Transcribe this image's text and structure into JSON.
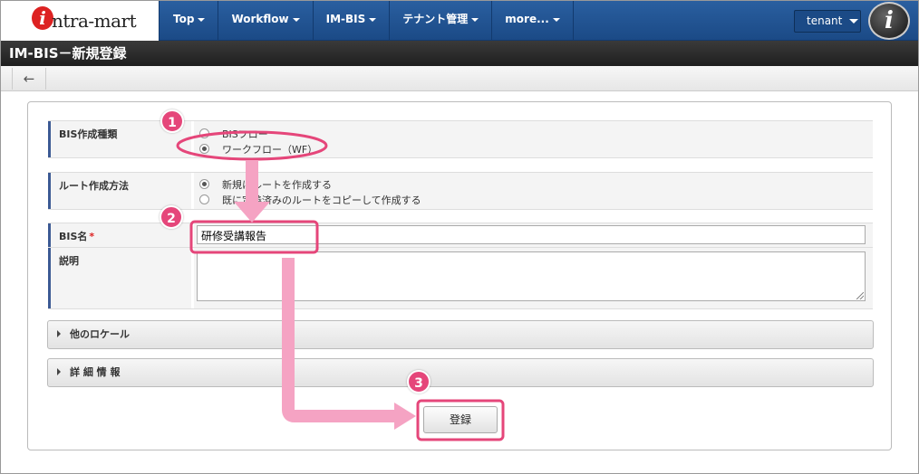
{
  "app": {
    "logo_text": "ntra-mart",
    "logo_mark": "i",
    "avatar_mark": "i"
  },
  "nav": [
    {
      "label": "Top"
    },
    {
      "label": "Workflow"
    },
    {
      "label": "IM-BIS"
    },
    {
      "label": "テナント管理"
    },
    {
      "label": "more..."
    }
  ],
  "tenant_label": "tenant",
  "page_title": "IM-BIS－新規登録",
  "back_icon": "←",
  "form": {
    "bis_type": {
      "label": "BIS作成種類",
      "options": [
        "BISフロー",
        "ワークフロー（WF）"
      ],
      "selected": 1
    },
    "route_method": {
      "label": "ルート作成方法",
      "options": [
        "新規にルートを作成する",
        "既に定義済みのルートをコピーして作成する"
      ],
      "selected": 0
    },
    "bis_name": {
      "label": "BIS名",
      "required_mark": "*",
      "value": "研修受講報告"
    },
    "description": {
      "label": "説明",
      "value": ""
    }
  },
  "sections": [
    {
      "label": "他のロケール"
    },
    {
      "label": "詳 細 情 報"
    }
  ],
  "submit_label": "登録",
  "annotations": {
    "step1": "1",
    "step2": "2",
    "step3": "3",
    "color": "#e5467a",
    "arrow_color": "#f5a3c3"
  }
}
